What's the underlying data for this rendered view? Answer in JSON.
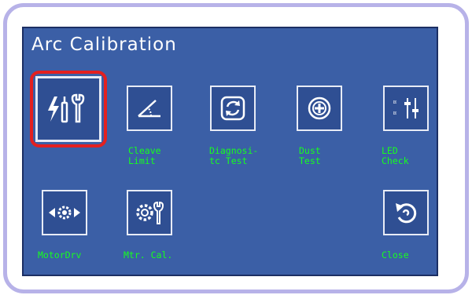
{
  "dialog": {
    "title": "Arc Calibration"
  },
  "buttons": [
    {
      "id": "arc-calibration",
      "label": "",
      "icon": "bolt-tools-icon",
      "selected": true
    },
    {
      "id": "cleave-limit",
      "label": "Cleave\nLimit",
      "icon": "angle-icon"
    },
    {
      "id": "diagnostic-test",
      "label": "Diagnosi-\ntc Test",
      "icon": "refresh-arrows-icon"
    },
    {
      "id": "dust-test",
      "label": "Dust\nTest",
      "icon": "target-plus-icon"
    },
    {
      "id": "led-check",
      "label": "LED\nCheck",
      "icon": "led-sliders-icon"
    },
    {
      "id": "motor-drv",
      "label": "MotorDrv",
      "icon": "motor-gear-arrows-icon"
    },
    {
      "id": "mtr-cal",
      "label": "Mtr. Cal.",
      "icon": "gear-wrench-icon"
    },
    {
      "id": "close",
      "label": "Close",
      "icon": "close-return-icon"
    }
  ],
  "colors": {
    "screen_bg": "#3b5fa6",
    "label_green": "#16ff1e",
    "selection_red": "#e32020",
    "frame_lavender": "#b7b2e8"
  }
}
